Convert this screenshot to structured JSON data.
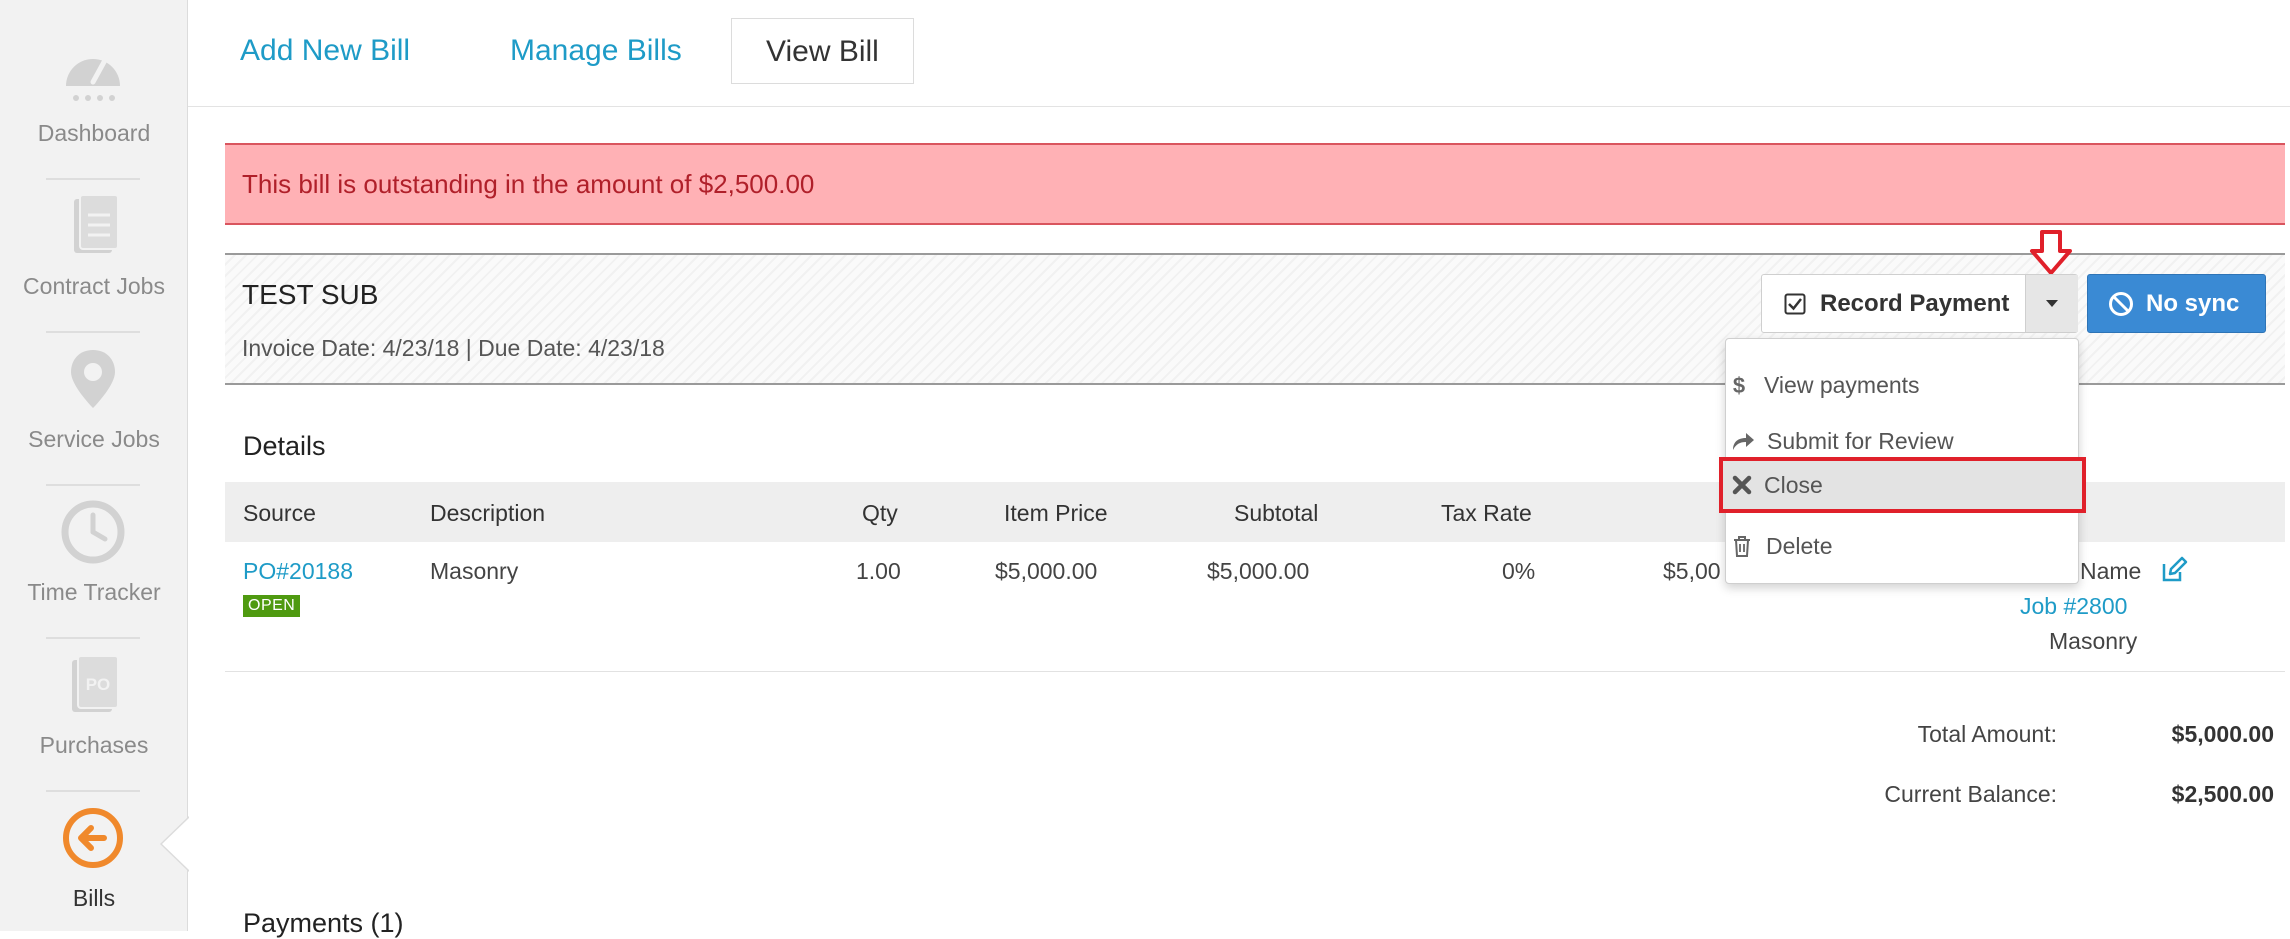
{
  "sidebar": {
    "items": [
      {
        "label": "Dashboard",
        "icon": "gauge-icon"
      },
      {
        "label": "Contract Jobs",
        "icon": "document-icon"
      },
      {
        "label": "Service Jobs",
        "icon": "map-pin-icon"
      },
      {
        "label": "Time Tracker",
        "icon": "clock-icon"
      },
      {
        "label": "Purchases",
        "icon": "po-icon"
      },
      {
        "label": "Bills",
        "icon": "arrow-left-circle-icon"
      }
    ],
    "accent": "#f0892c"
  },
  "tabs": [
    {
      "label": "Add New Bill"
    },
    {
      "label": "Manage Bills"
    },
    {
      "label": "View Bill",
      "active": true
    }
  ],
  "alert": {
    "text": "This bill is outstanding in the amount of $2,500.00"
  },
  "bill": {
    "vendor": "TEST SUB",
    "dates": "Invoice Date: 4/23/18 | Due Date: 4/23/18"
  },
  "actions": {
    "record_payment": "Record Payment",
    "no_sync": "No sync",
    "dropdown": [
      {
        "label": "View payments",
        "icon": "dollar-icon"
      },
      {
        "label": "Submit for Review",
        "icon": "share-icon"
      },
      {
        "label": "Close",
        "icon": "x-icon",
        "highlighted": true
      },
      {
        "label": "Delete",
        "icon": "trash-icon"
      }
    ]
  },
  "details": {
    "title": "Details",
    "columns": [
      "Source",
      "Description",
      "Qty",
      "Item Price",
      "Subtotal",
      "Tax Rate"
    ],
    "row": {
      "source": "PO#20188",
      "status": "OPEN",
      "description": "Masonry",
      "qty": "1.00",
      "item_price": "$5,000.00",
      "subtotal": "$5,000.00",
      "tax_rate": "0%",
      "total_partial": "$5,00",
      "name_partial": "Name",
      "job": "Job #2800",
      "job_desc": "Masonry"
    }
  },
  "totals": {
    "total_amount_label": "Total Amount:",
    "total_amount": "$5,000.00",
    "balance_label": "Current Balance:",
    "balance": "$2,500.00"
  },
  "payments": {
    "title": "Payments (1)"
  }
}
